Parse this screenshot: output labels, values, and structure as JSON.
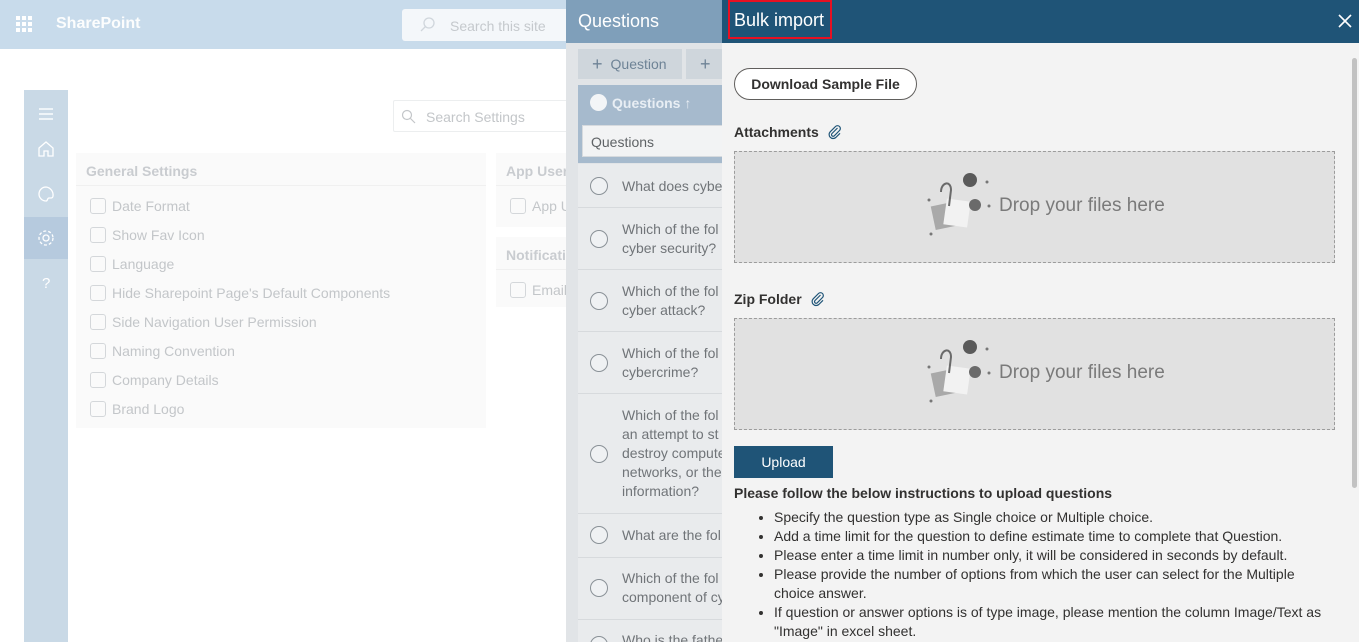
{
  "app": {
    "brand": "SharePoint"
  },
  "topbar": {
    "search_placeholder": "Search this site"
  },
  "settings": {
    "search_placeholder": "Search Settings",
    "general_title": "General Settings",
    "general_items": [
      "Date Format",
      "Show Fav Icon",
      "Language",
      "Hide Sharepoint Page's Default Components",
      "Side Navigation User Permission",
      "Naming Convention",
      "Company Details",
      "Brand Logo"
    ],
    "app_users_title": "App User",
    "app_users_item": "App U",
    "notifications_title": "Notificati",
    "notifications_item": "Email"
  },
  "questions_panel": {
    "title": "Questions",
    "add_question_label": "Question",
    "column_header": "Questions ↑",
    "filter_value": "Questions",
    "rows": [
      "What does cyber",
      "Which of the fol\ncyber security?",
      "Which of the fol\ncyber attack?",
      "Which of the fol\ncybercrime?",
      "Which of the fol\nan attempt to st\ndestroy compute\nnetworks, or the\ninformation?",
      "What are the fol",
      "Which of the fol\ncomponent of cy",
      "Who is the fathe"
    ]
  },
  "dialog": {
    "title": "Bulk import",
    "download_label": "Download Sample File",
    "attachments_label": "Attachments",
    "zip_label": "Zip Folder",
    "drop_text": "Drop your files here",
    "upload_label": "Upload",
    "instructions_title": "Please follow the below instructions to upload questions",
    "instructions": [
      "Specify the question type as Single choice or Multiple choice.",
      "Add a time limit for the question to define estimate time to complete that Question.",
      "Please enter a time limit in number only, it will be considered in seconds by default.",
      "Please provide the number of options from which the user can select for the Multiple choice answer.",
      "If question or answer options is of type image, please mention the column Image/Text as \"Image\" in excel sheet."
    ]
  },
  "colors": {
    "header_blue": "#1f5477",
    "highlight_red": "#e81123",
    "sp_bar": "#c8dbeb"
  }
}
